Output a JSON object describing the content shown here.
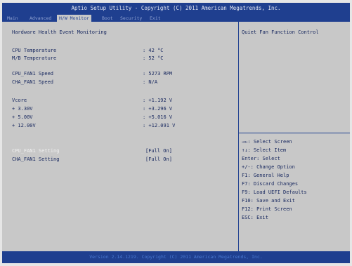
{
  "title": "Aptio Setup Utility - Copyright (C) 2011 American Megatrends, Inc.",
  "tabs": [
    {
      "label": "Main"
    },
    {
      "label": "Advanced"
    },
    {
      "label": "H/W Monitor"
    },
    {
      "label": "Boot"
    },
    {
      "label": "Security"
    },
    {
      "label": "Exit"
    }
  ],
  "section_title": "Hardware Health Event Monitoring",
  "readings": {
    "cpu_temp": {
      "label": "CPU Temperature",
      "value": ": 42 °C"
    },
    "mb_temp": {
      "label": "M/B Temperature",
      "value": ": 52 °C"
    },
    "cpu_fan": {
      "label": "CPU_FAN1 Speed",
      "value": ": 5273 RPM"
    },
    "cha_fan": {
      "label": "CHA_FAN1 Speed",
      "value": ": N/A"
    },
    "vcore": {
      "label": "Vcore",
      "value": ": +1.192 V"
    },
    "v33": {
      "label": "+ 3.30V",
      "value": ": +3.296 V"
    },
    "v5": {
      "label": "+ 5.00V",
      "value": ": +5.016 V"
    },
    "v12": {
      "label": "+ 12.00V",
      "value": ": +12.091 V"
    }
  },
  "settings": {
    "cpu_fan": {
      "label": "CPU_FAN1 Setting",
      "value": "[Full On]"
    },
    "cha_fan": {
      "label": "CHA_FAN1 Setting",
      "value": "[Full On]"
    }
  },
  "help_title": "Quiet Fan Function Control",
  "keys": [
    "→←: Select Screen",
    "↑↓: Select Item",
    "Enter: Select",
    "+/-: Change Option",
    "F1: General Help",
    "F7: Discard Changes",
    "F9: Load UEFI Defaults",
    "F10: Save and Exit",
    "F12: Print Screen",
    "ESC: Exit"
  ],
  "footer": "Version 2.14.1219. Copyright (C) 2011 American Megatrends, Inc."
}
